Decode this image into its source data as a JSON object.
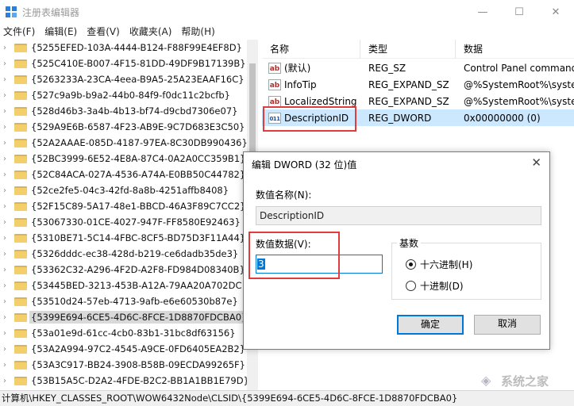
{
  "window": {
    "title": "注册表编辑器",
    "minimize": "—",
    "maximize": "☐",
    "close": "✕"
  },
  "menu": [
    "文件(F)",
    "编辑(E)",
    "查看(V)",
    "收藏夹(A)",
    "帮助(H)"
  ],
  "tree": {
    "expand_glyph": "›",
    "items": [
      "{5255EFED-103A-4444-B124-F88F99E4EF8D}",
      "{525C410E-B007-4F15-81DD-49DF9B17139B}",
      "{5263233A-23CA-4eea-B9A5-25A23EAAF16C}",
      "{527c9a9b-b9a2-44b0-84f9-f0dc11c2bcfb}",
      "{528d46b3-3a4b-4b13-bf74-d9cbd7306e07}",
      "{529A9E6B-6587-4F23-AB9E-9C7D683E3C50}",
      "{52A2AAAE-085D-4187-97EA-8C30DB990436}",
      "{52BC3999-6E52-4E8A-87C4-0A2A0CC359B1}",
      "{52C84ACA-027A-4536-A74A-E0BB50C44782}",
      "{52ce2fe5-04c3-42fd-8a8b-4251affb8408}",
      "{52F15C89-5A17-48e1-BBCD-46A3F89C7CC2}",
      "{53067330-01CE-4027-947F-FF8580E92463}",
      "{5310BE71-5C14-4FBC-8CF5-BD75D3F11A44}",
      "{5326dddc-ec38-428d-b219-ce6dadb35de3}",
      "{53362C32-A296-4F2D-A2F8-FD984D08340B}",
      "{53445BED-3213-453B-A12A-79AA20A702DC}",
      "{53510d24-57eb-4713-9afb-e6e60530b87e}",
      "{5399E694-6CE5-4D6C-8FCE-1D8870FDCBA0}",
      "{53a01e9d-61cc-4cb0-83b1-31bc8df63156}",
      "{53A2A994-97C2-4545-A9CE-0FD6405EA2B2}",
      "{53A3C917-BB24-3908-B58B-09ECDA99265F}",
      "{53B15A5C-D2A2-4FDE-B2C2-BB1A1BB1E79D}"
    ],
    "selected_index": 17
  },
  "list": {
    "headers": {
      "name": "名称",
      "type": "类型",
      "data": "数据"
    },
    "rows": [
      {
        "name": "(默认)",
        "type": "REG_SZ",
        "data": "Control Panel command",
        "icon": "ab"
      },
      {
        "name": "InfoTip",
        "type": "REG_EXPAND_SZ",
        "data": "@%SystemRoot%\\syster",
        "icon": "ab"
      },
      {
        "name": "LocalizedString",
        "type": "REG_EXPAND_SZ",
        "data": "@%SystemRoot%\\syster",
        "icon": "ab"
      },
      {
        "name": "DescriptionID",
        "type": "REG_DWORD",
        "data": "0x00000000 (0)",
        "icon": "011"
      }
    ],
    "selected_index": 3
  },
  "status": "计算机\\HKEY_CLASSES_ROOT\\WOW6432Node\\CLSID\\{5399E694-6CE5-4D6C-8FCE-1D8870FDCBA0}",
  "dialog": {
    "title": "编辑 DWORD (32 位)值",
    "close": "✕",
    "name_label": "数值名称(N):",
    "name_value": "DescriptionID",
    "data_label": "数值数据(V):",
    "data_value": "3",
    "base_label": "基数",
    "radio_hex": "十六进制(H)",
    "radio_dec": "十进制(D)",
    "ok": "确定",
    "cancel": "取消"
  },
  "watermark": "系统之家",
  "colors": {
    "accent": "#0078d7",
    "selection": "#cce8ff",
    "highlight_box": "#e03c3c"
  }
}
